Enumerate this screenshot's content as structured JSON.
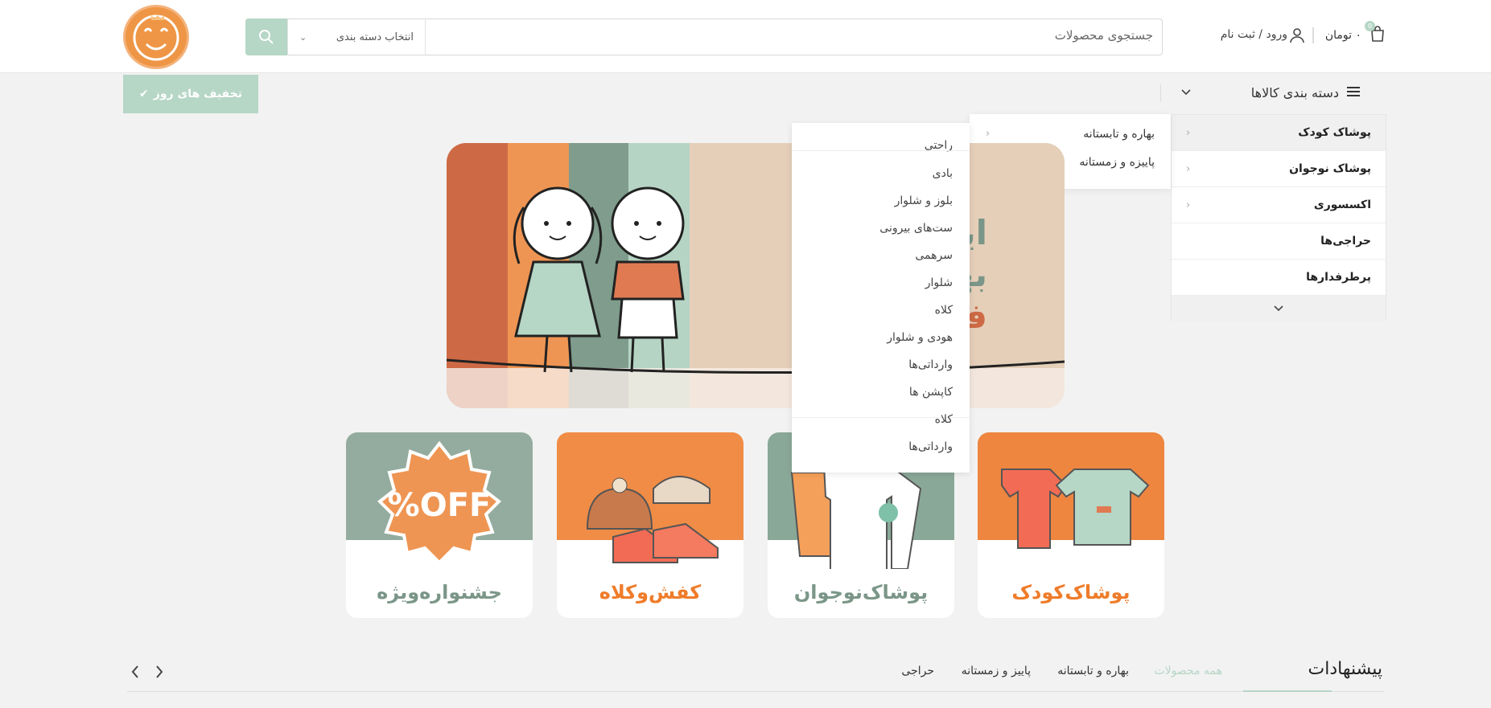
{
  "header": {
    "search_placeholder": "جستجوی محصولات",
    "category_select": "انتخاب دسته بندی",
    "cart_amount": "۰ تومان",
    "cart_badge": "0",
    "login": "ورود / ثبت نام"
  },
  "nav": {
    "categories_label": "دسته بندی کالاها",
    "daily_deals": "تخفیف های روز"
  },
  "sidebar": {
    "items": [
      {
        "label": "پوشاک کودک"
      },
      {
        "label": "پوشاک نوجوان"
      },
      {
        "label": "اکسسوری"
      },
      {
        "label": "حراجی‌ها"
      },
      {
        "label": "پرطرفدارها"
      }
    ]
  },
  "submenu": {
    "items": [
      {
        "label": "بهاره و تابستانه"
      },
      {
        "label": "پاییزه و زمستانه"
      }
    ]
  },
  "dropdown": {
    "items": [
      "راحتی",
      "بادی",
      "بلوز و شلوار",
      "ست‌های بیرونی",
      "سرهمی",
      "شلوار",
      "کلاه",
      "هودی و شلوار",
      "وارداتی‌ها",
      "کاپشن ها",
      "کلاه",
      "وارداتی‌ها"
    ]
  },
  "banner": {
    "text_line1": "این‌ از",
    "text_line2": "بهـ ی",
    "text_line3": "فر ت...",
    "colors": [
      "#cd6a45",
      "#ef9553",
      "#7f9c8c",
      "#b5d4c4",
      "#e5cfb9"
    ]
  },
  "cards": [
    {
      "title": "پوشاک‌کودک",
      "color": "#ef7c2a",
      "top": "#ee8640"
    },
    {
      "title": "پوشاک‌نوجوان",
      "color": "#7b9688",
      "top": "#8aa898"
    },
    {
      "title": "کفش‌وکلاه",
      "color": "#ef7c2a",
      "top": "#f08c46"
    },
    {
      "title": "جشنواره‌ویژه",
      "color": "#7b9688",
      "top": "#94ac9f",
      "badge": "%OFF"
    }
  ],
  "bottom": {
    "suggestions": "پیشنهادات",
    "tabs": [
      "همه محصولات",
      "بهاره و تابستانه",
      "پاییز و زمستانه",
      "حراجی"
    ],
    "accent": "#b6d6c6"
  }
}
